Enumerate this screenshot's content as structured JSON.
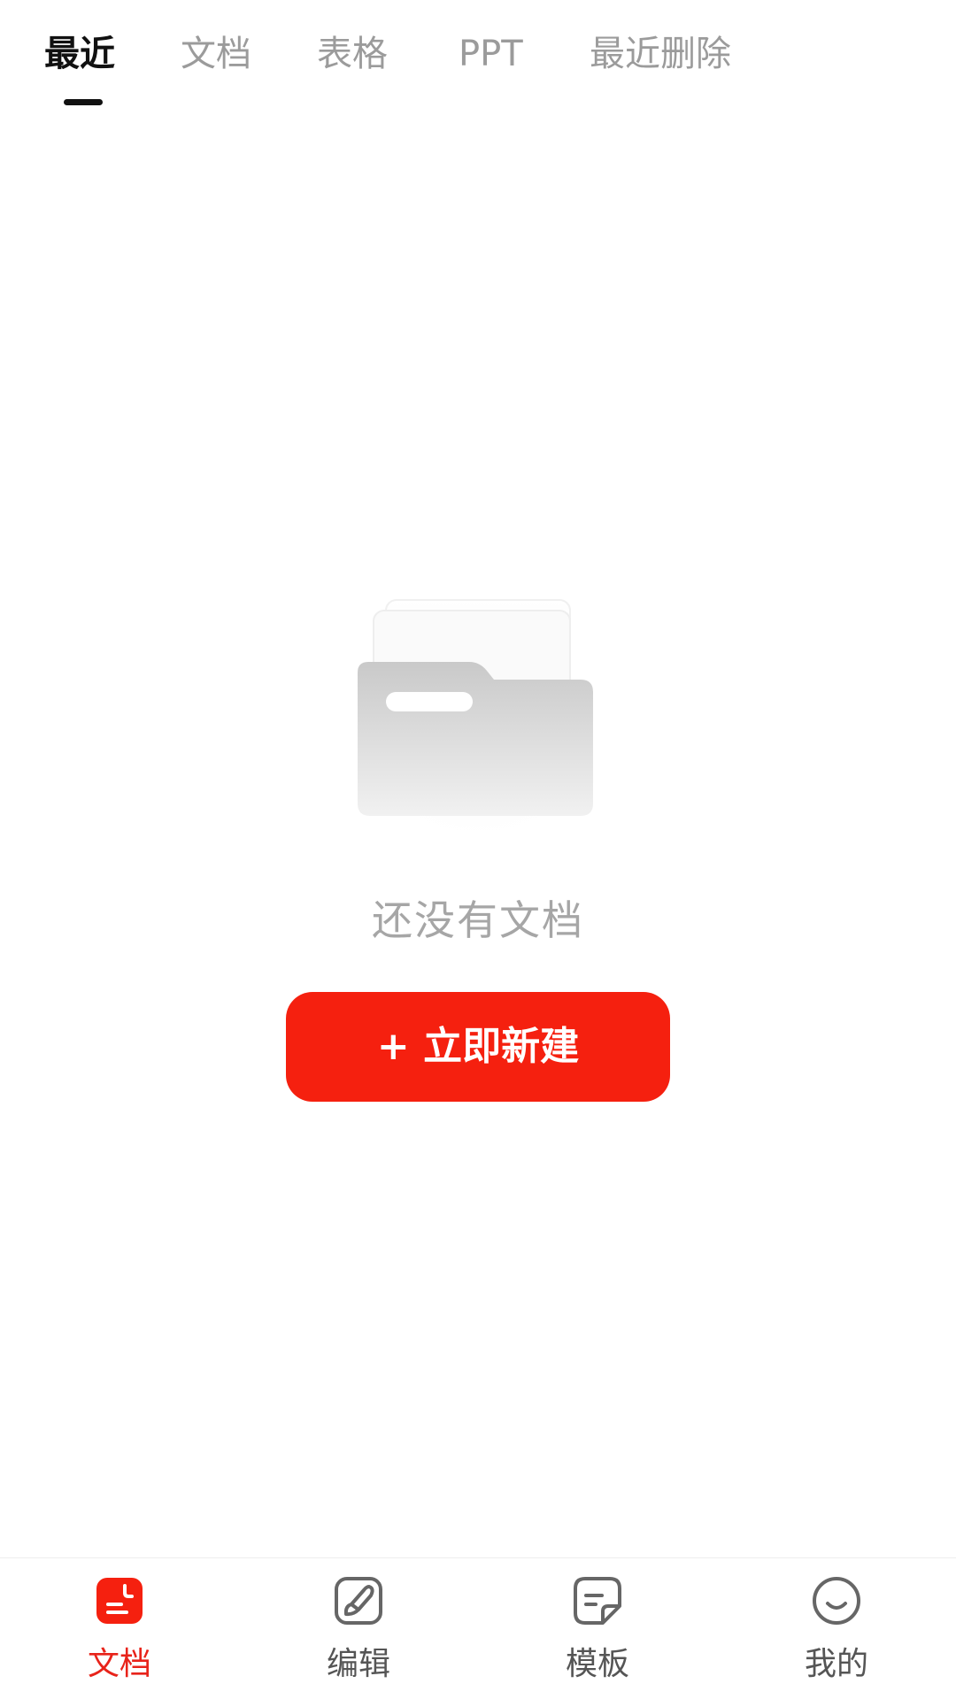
{
  "tabs": [
    {
      "label": "最近",
      "active": true
    },
    {
      "label": "文档",
      "active": false
    },
    {
      "label": "表格",
      "active": false
    },
    {
      "label": "PPT",
      "active": false
    },
    {
      "label": "最近删除",
      "active": false
    }
  ],
  "empty_state": {
    "icon": "folder-icon",
    "message": "还没有文档",
    "create_button_label": "+ 立即新建"
  },
  "bottom_nav": [
    {
      "label": "文档",
      "icon": "document-icon",
      "active": true
    },
    {
      "label": "编辑",
      "icon": "brush-icon",
      "active": false
    },
    {
      "label": "模板",
      "icon": "template-icon",
      "active": false
    },
    {
      "label": "我的",
      "icon": "smiley-icon",
      "active": false
    }
  ],
  "colors": {
    "accent": "#f5200f",
    "nav_active": "#e8231a",
    "tab_active": "#111111",
    "tab_inactive": "#9b9b9b",
    "muted_text": "#a6a6a6"
  }
}
